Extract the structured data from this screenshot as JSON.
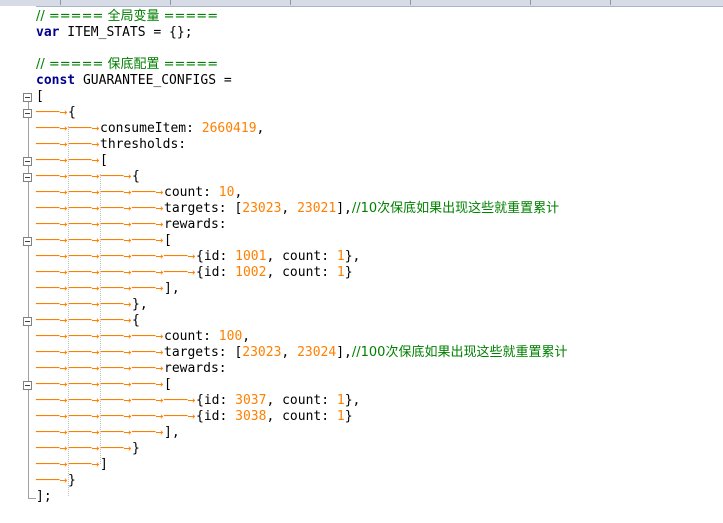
{
  "lines": [
    {
      "type": "comment",
      "text": "// ===== 全局变量 ====="
    },
    {
      "type": "code",
      "parts": [
        {
          "k": "kw",
          "t": "var"
        },
        {
          "k": "p",
          "t": " ITEM_STATS = {};"
        }
      ]
    },
    {
      "type": "blank"
    },
    {
      "type": "comment",
      "text": "// ===== 保底配置 ====="
    },
    {
      "type": "code",
      "parts": [
        {
          "k": "kw",
          "t": "const"
        },
        {
          "k": "p",
          "t": " GUARANTEE_CONFIGS = "
        }
      ]
    },
    {
      "type": "code",
      "parts": [
        {
          "k": "p",
          "t": "["
        }
      ]
    },
    {
      "type": "code",
      "indent": 1,
      "parts": [
        {
          "k": "p",
          "t": "{"
        }
      ]
    },
    {
      "type": "code",
      "indent": 2,
      "parts": [
        {
          "k": "p",
          "t": "consumeItem: "
        },
        {
          "k": "n",
          "t": "2660419"
        },
        {
          "k": "p",
          "t": ","
        }
      ]
    },
    {
      "type": "code",
      "indent": 2,
      "parts": [
        {
          "k": "p",
          "t": "thresholds: "
        }
      ]
    },
    {
      "type": "code",
      "indent": 2,
      "parts": [
        {
          "k": "p",
          "t": "["
        }
      ]
    },
    {
      "type": "code",
      "indent": 3,
      "parts": [
        {
          "k": "p",
          "t": "{"
        }
      ]
    },
    {
      "type": "code",
      "indent": 4,
      "parts": [
        {
          "k": "p",
          "t": "count: "
        },
        {
          "k": "n",
          "t": "10"
        },
        {
          "k": "p",
          "t": ","
        }
      ]
    },
    {
      "type": "code",
      "indent": 4,
      "parts": [
        {
          "k": "p",
          "t": "targets: ["
        },
        {
          "k": "n",
          "t": "23023"
        },
        {
          "k": "p",
          "t": ", "
        },
        {
          "k": "n",
          "t": "23021"
        },
        {
          "k": "p",
          "t": "],"
        },
        {
          "k": "c",
          "t": "//10次保底如果出现这些就重置累计"
        }
      ]
    },
    {
      "type": "code",
      "indent": 4,
      "parts": [
        {
          "k": "p",
          "t": "rewards: "
        }
      ]
    },
    {
      "type": "code",
      "indent": 4,
      "parts": [
        {
          "k": "p",
          "t": "["
        }
      ]
    },
    {
      "type": "code",
      "indent": 5,
      "parts": [
        {
          "k": "p",
          "t": "{id: "
        },
        {
          "k": "n",
          "t": "1001"
        },
        {
          "k": "p",
          "t": ", count: "
        },
        {
          "k": "n",
          "t": "1"
        },
        {
          "k": "p",
          "t": "},"
        }
      ]
    },
    {
      "type": "code",
      "indent": 5,
      "parts": [
        {
          "k": "p",
          "t": "{id: "
        },
        {
          "k": "n",
          "t": "1002"
        },
        {
          "k": "p",
          "t": ", count: "
        },
        {
          "k": "n",
          "t": "1"
        },
        {
          "k": "p",
          "t": "}"
        }
      ]
    },
    {
      "type": "code",
      "indent": 4,
      "parts": [
        {
          "k": "p",
          "t": "],"
        }
      ]
    },
    {
      "type": "code",
      "indent": 3,
      "parts": [
        {
          "k": "p",
          "t": "},"
        }
      ]
    },
    {
      "type": "code",
      "indent": 3,
      "parts": [
        {
          "k": "p",
          "t": "{"
        }
      ]
    },
    {
      "type": "code",
      "indent": 4,
      "parts": [
        {
          "k": "p",
          "t": "count: "
        },
        {
          "k": "n",
          "t": "100"
        },
        {
          "k": "p",
          "t": ","
        }
      ]
    },
    {
      "type": "code",
      "indent": 4,
      "parts": [
        {
          "k": "p",
          "t": "targets: ["
        },
        {
          "k": "n",
          "t": "23023"
        },
        {
          "k": "p",
          "t": ", "
        },
        {
          "k": "n",
          "t": "23024"
        },
        {
          "k": "p",
          "t": "],"
        },
        {
          "k": "c",
          "t": "//100次保底如果出现这些就重置累计"
        }
      ]
    },
    {
      "type": "code",
      "indent": 4,
      "parts": [
        {
          "k": "p",
          "t": "rewards: "
        }
      ]
    },
    {
      "type": "code",
      "indent": 4,
      "parts": [
        {
          "k": "p",
          "t": "["
        }
      ]
    },
    {
      "type": "code",
      "indent": 5,
      "parts": [
        {
          "k": "p",
          "t": "{id: "
        },
        {
          "k": "n",
          "t": "3037"
        },
        {
          "k": "p",
          "t": ", count: "
        },
        {
          "k": "n",
          "t": "1"
        },
        {
          "k": "p",
          "t": "},"
        }
      ]
    },
    {
      "type": "code",
      "indent": 5,
      "parts": [
        {
          "k": "p",
          "t": "{id: "
        },
        {
          "k": "n",
          "t": "3038"
        },
        {
          "k": "p",
          "t": ", count: "
        },
        {
          "k": "n",
          "t": "1"
        },
        {
          "k": "p",
          "t": "}"
        }
      ]
    },
    {
      "type": "code",
      "indent": 4,
      "parts": [
        {
          "k": "p",
          "t": "],"
        }
      ]
    },
    {
      "type": "code",
      "indent": 3,
      "parts": [
        {
          "k": "p",
          "t": "}"
        }
      ]
    },
    {
      "type": "code",
      "indent": 2,
      "parts": [
        {
          "k": "p",
          "t": "]"
        }
      ]
    },
    {
      "type": "code",
      "indent": 1,
      "parts": [
        {
          "k": "p",
          "t": "}"
        }
      ]
    },
    {
      "type": "code",
      "parts": [
        {
          "k": "p",
          "t": "];"
        }
      ]
    }
  ],
  "colors": {
    "comment": "#008000",
    "keyword": "#00008b",
    "number": "#ff8000",
    "whitespace": "#ff8000"
  }
}
